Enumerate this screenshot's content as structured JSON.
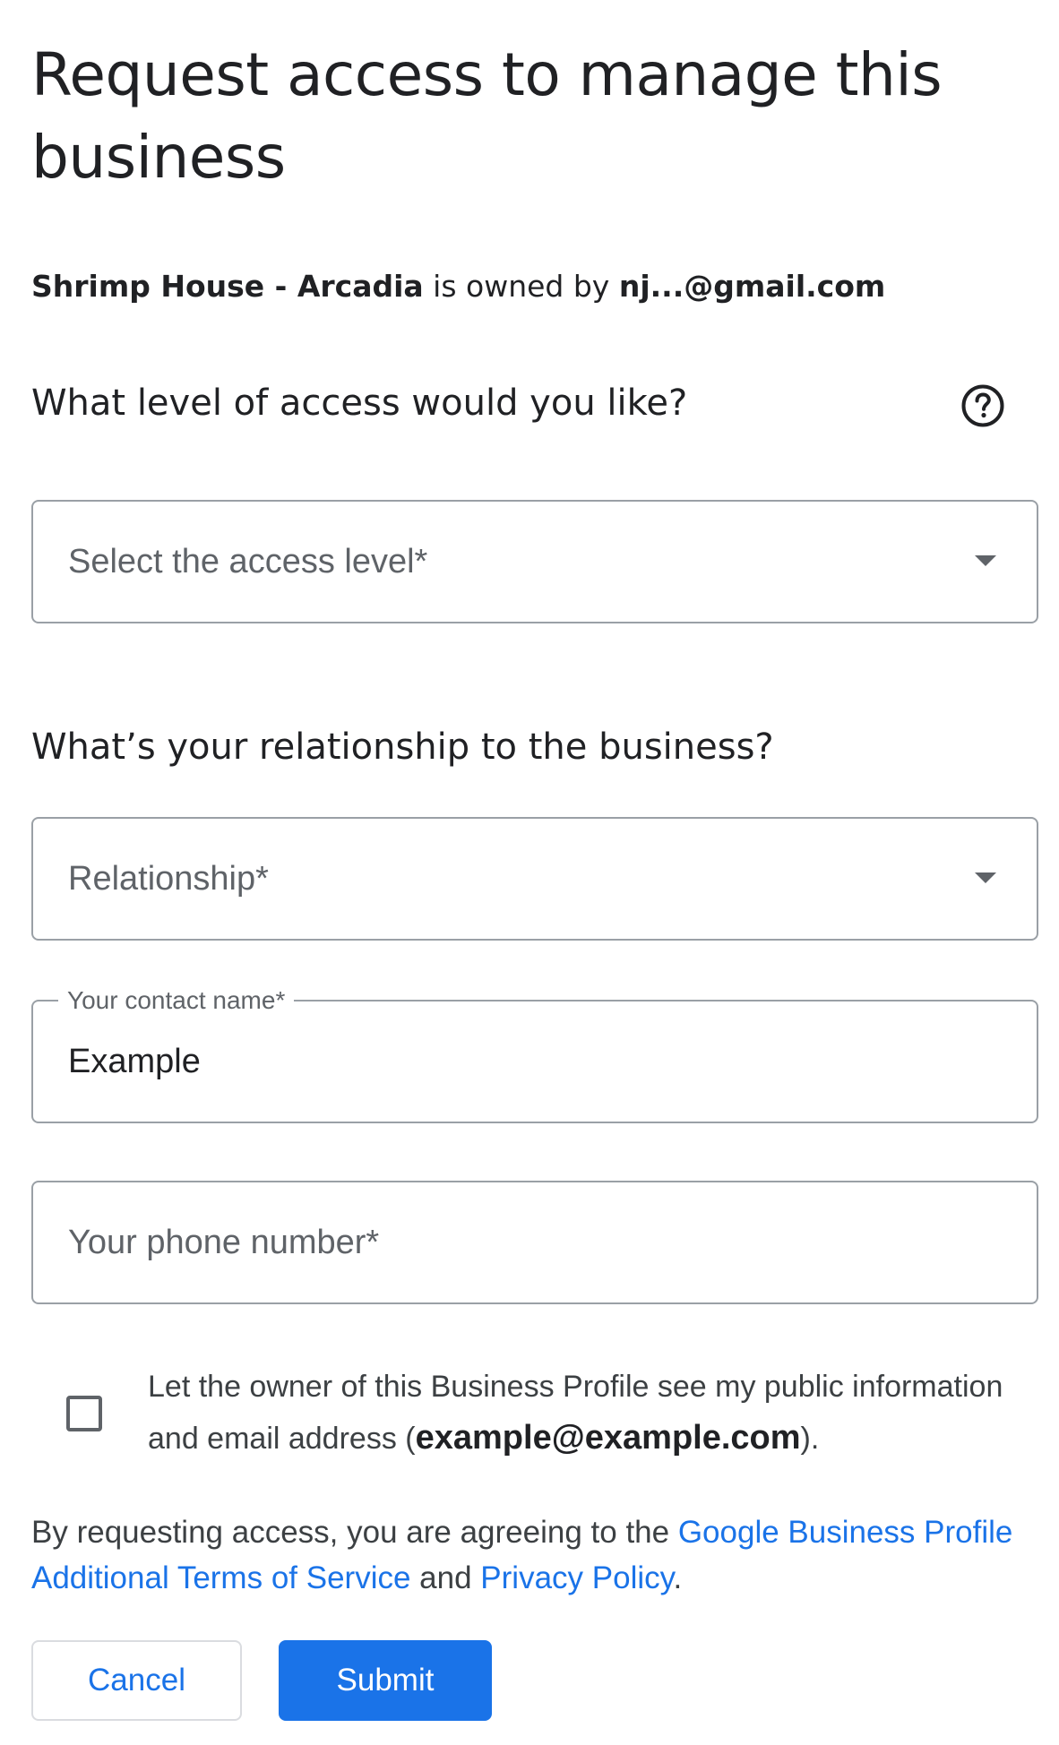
{
  "page": {
    "title": "Request access to manage this business"
  },
  "owner": {
    "business_name": "Shrimp House - Arcadia",
    "connector": " is owned by ",
    "owner_email": "nj...@gmail.com"
  },
  "access": {
    "question": "What level of access would you like?",
    "help_icon": "help-circle-icon",
    "select_placeholder": "Select the access level*"
  },
  "relationship": {
    "question": "What’s your relationship to the business?",
    "select_placeholder": "Relationship*"
  },
  "contact_name": {
    "label": "Your contact name*",
    "value": "Example"
  },
  "phone": {
    "placeholder": "Your phone number*"
  },
  "consent": {
    "text_before": "Let the owner of this Business Profile see my public information and email address (",
    "email": "example@example.com",
    "text_after": ").",
    "checked": false
  },
  "terms": {
    "prefix": "By requesting access, you are agreeing to the ",
    "terms_link": "Google Business Profile Additional Terms of Service",
    "middle": " and ",
    "privacy_link": "Privacy Policy",
    "suffix": "."
  },
  "buttons": {
    "cancel": "Cancel",
    "submit": "Submit"
  },
  "colors": {
    "primary": "#1a73e8",
    "text": "#202124",
    "muted": "#5f6368",
    "border": "#9aa0a6"
  }
}
